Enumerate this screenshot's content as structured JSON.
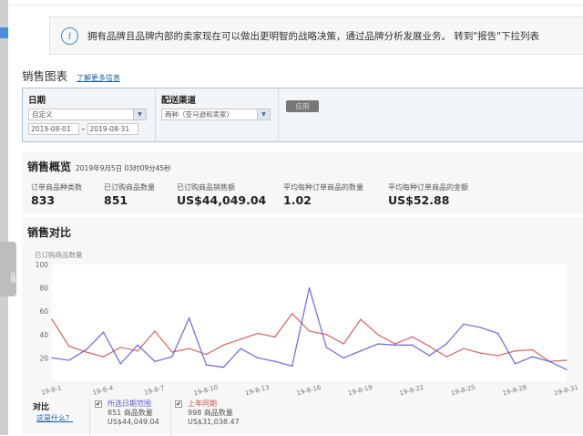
{
  "side_tab": "反馈",
  "banner": {
    "text": "拥有品牌且品牌内部的卖家现在可以做出更明智的战略决策，通过品牌分析发展业务。 转到\"报告\"下拉列表"
  },
  "header": {
    "title": "销售图表",
    "learn_more": "了解更多信息"
  },
  "filters": {
    "date_label": "日期",
    "date_select": "自定义",
    "start": "2019-08-01",
    "sep": "–",
    "end": "2019-08-31",
    "channel_label": "配送渠道",
    "channel_select": "两种（亚马逊和卖家）",
    "apply": "应用"
  },
  "overview": {
    "title": "销售概览",
    "timestamp": "2019年9月5日 03时09分45秒",
    "metrics": [
      {
        "label": "订单商品种类数",
        "value": "833"
      },
      {
        "label": "已订购商品数量",
        "value": "851"
      },
      {
        "label": "已订购商品销售额",
        "value": "US$44,049.04"
      },
      {
        "label": "平均每种订单商品的数量",
        "value": "1.02"
      },
      {
        "label": "平均每种订单商品的金额",
        "value": "US$52.88"
      }
    ]
  },
  "compare": {
    "title": "销售对比",
    "legend_title": "对比",
    "help": "这是什么？",
    "current": {
      "label": "所选日期范围",
      "qty": "851 商品数量",
      "sales": "US$44,049.04",
      "color": "#5b5bd6"
    },
    "previous": {
      "label": "上年同期",
      "qty": "998 商品数量",
      "sales": "US$31,038.47",
      "color": "#d05454"
    }
  },
  "chart_data": {
    "type": "line",
    "ylabel": "已订购商品数量",
    "ylim": [
      0,
      100
    ],
    "yticks": [
      20,
      40,
      60,
      80,
      100
    ],
    "x": [
      "19-8-1",
      "19-8-2",
      "19-8-3",
      "19-8-4",
      "19-8-5",
      "19-8-6",
      "19-8-7",
      "19-8-8",
      "19-8-9",
      "19-8-10",
      "19-8-11",
      "19-8-12",
      "19-8-13",
      "19-8-14",
      "19-8-15",
      "19-8-16",
      "19-8-17",
      "19-8-18",
      "19-8-19",
      "19-8-20",
      "19-8-21",
      "19-8-22",
      "19-8-23",
      "19-8-24",
      "19-8-25",
      "19-8-26",
      "19-8-27",
      "19-8-28",
      "19-8-29",
      "19-8-30",
      "19-8-31"
    ],
    "xticks": [
      "19-8-1",
      "19-8-4",
      "19-8-7",
      "19-8-10",
      "19-8-13",
      "19-8-16",
      "19-8-19",
      "19-8-22",
      "19-8-25",
      "19-8-28",
      "19-8-31"
    ],
    "series": [
      {
        "name": "所选日期范围",
        "color": "#5b5bd6",
        "values": [
          20,
          18,
          27,
          42,
          15,
          31,
          17,
          21,
          54,
          14,
          12,
          28,
          20,
          17,
          13,
          80,
          29,
          20,
          26,
          32,
          31,
          31,
          22,
          32,
          49,
          46,
          41,
          15,
          21,
          17,
          10
        ]
      },
      {
        "name": "上年同期",
        "color": "#d05454",
        "values": [
          53,
          30,
          25,
          21,
          29,
          26,
          43,
          25,
          28,
          23,
          31,
          36,
          41,
          38,
          58,
          43,
          40,
          32,
          53,
          40,
          32,
          38,
          30,
          21,
          28,
          24,
          22,
          26,
          27,
          17,
          18
        ]
      }
    ]
  }
}
